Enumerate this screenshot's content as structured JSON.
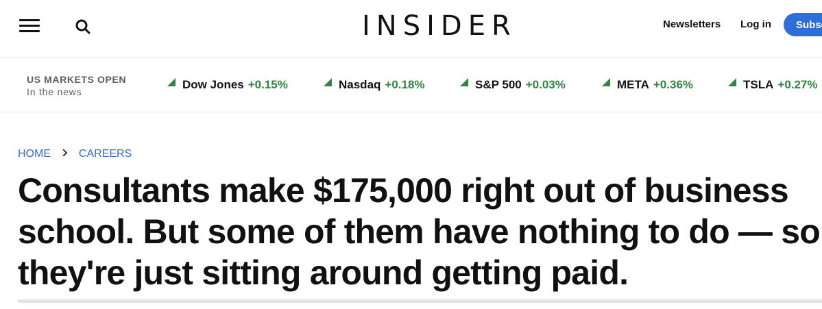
{
  "header": {
    "logo": "INSIDER",
    "newsletters_label": "Newsletters",
    "login_label": "Log in",
    "subscribe_label": "Subscribe",
    "accent_color": "#2f6ed9"
  },
  "markets": {
    "status": "US MARKETS OPEN",
    "subtitle": "In the news",
    "tickers": [
      {
        "name": "Dow Jones",
        "change": "+0.15%"
      },
      {
        "name": "Nasdaq",
        "change": "+0.18%"
      },
      {
        "name": "S&P 500",
        "change": "+0.03%"
      },
      {
        "name": "META",
        "change": "+0.36%"
      },
      {
        "name": "TSLA",
        "change": "+0.27%"
      }
    ],
    "up_color": "#2e8540"
  },
  "breadcrumb": {
    "home": "HOME",
    "section": "CAREERS"
  },
  "article": {
    "headline_line1": "Consultants make $175,000 right out of business",
    "headline_line2": "school. But some of them have nothing to do — so",
    "headline_line3": "they're just sitting around getting paid."
  }
}
